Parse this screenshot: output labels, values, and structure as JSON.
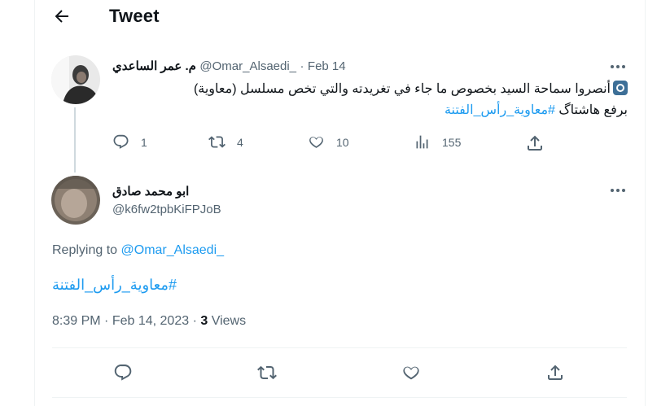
{
  "header": {
    "title": "Tweet",
    "back_icon": "arrow-left-icon"
  },
  "parent_tweet": {
    "display_name": "م. عمر الساعدي",
    "handle": "@Omar_Alsaedi_",
    "separator": "·",
    "date": "Feb 14",
    "text_line1": "أنصروا سماحة السيد بخصوص ما جاء في تغريدته والتي تخص مسلسل (معاوية)",
    "text_line2_prefix": "برفع هاشتاگ",
    "hashtag": "#معاوية_رأس_الفتنة",
    "stats": {
      "replies": "1",
      "retweets": "4",
      "likes": "10",
      "views": "155"
    }
  },
  "main_tweet": {
    "display_name": "ابو محمد صادق",
    "handle": "@k6fw2tpbKiFPJoB",
    "replying_to_label": "Replying to",
    "replying_to_handle": "@Omar_Alsaedi_",
    "hashtag": "#معاوية_رأس_الفتنة",
    "time": "8:39 PM",
    "separator": "·",
    "date": "Feb 14, 2023",
    "separator2": "·",
    "views_count": "3",
    "views_label": "Views"
  },
  "colors": {
    "accent": "#1d9bf0",
    "text": "#0f1419",
    "secondary": "#536471",
    "border": "#eff3f4"
  }
}
